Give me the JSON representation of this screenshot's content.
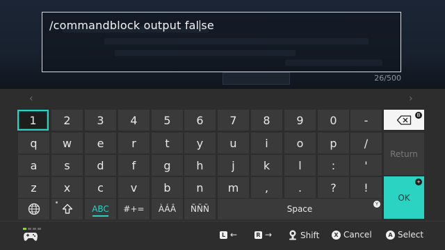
{
  "input": {
    "text_before_caret": "/commandblock output fal",
    "text_after_caret": "se",
    "counter": "26/500"
  },
  "keyboard": {
    "rows": [
      [
        "1",
        "2",
        "3",
        "4",
        "5",
        "6",
        "7",
        "8",
        "9",
        "0",
        "-"
      ],
      [
        "q",
        "w",
        "e",
        "r",
        "t",
        "y",
        "u",
        "i",
        "o",
        "p",
        "/"
      ],
      [
        "a",
        "s",
        "d",
        "f",
        "g",
        "h",
        "j",
        "k",
        "l",
        ":",
        "'"
      ],
      [
        "z",
        "x",
        "c",
        "v",
        "b",
        "n",
        "m",
        ",",
        ".",
        "?",
        "!"
      ]
    ],
    "selected_key": "1",
    "bottom_row": {
      "globe_icon": "globe-icon",
      "shift_icon": "shift-arrow-icon",
      "mode_abc": "ABC",
      "mode_symbols": "#+=",
      "mode_accents_a": "ÀÁÂ",
      "mode_accents_n": "ÑÑÑ",
      "space": "Space",
      "space_badge": "Y"
    },
    "side": {
      "backspace_badge": "B",
      "return": "Return",
      "ok": "OK",
      "ok_badge": "+"
    },
    "nav_left": "‹",
    "nav_right": "›"
  },
  "footer": {
    "hints": [
      {
        "button": "L",
        "label": "←"
      },
      {
        "button": "R",
        "label": "→"
      },
      {
        "button": "stick",
        "label": "Shift"
      },
      {
        "button": "X",
        "label": "Cancel"
      },
      {
        "button": "A",
        "label": "Select"
      }
    ]
  },
  "colors": {
    "accent": "#2bd3c3",
    "key_bg": "#3a3a3a",
    "keyboard_bg": "#2d2d2d"
  }
}
